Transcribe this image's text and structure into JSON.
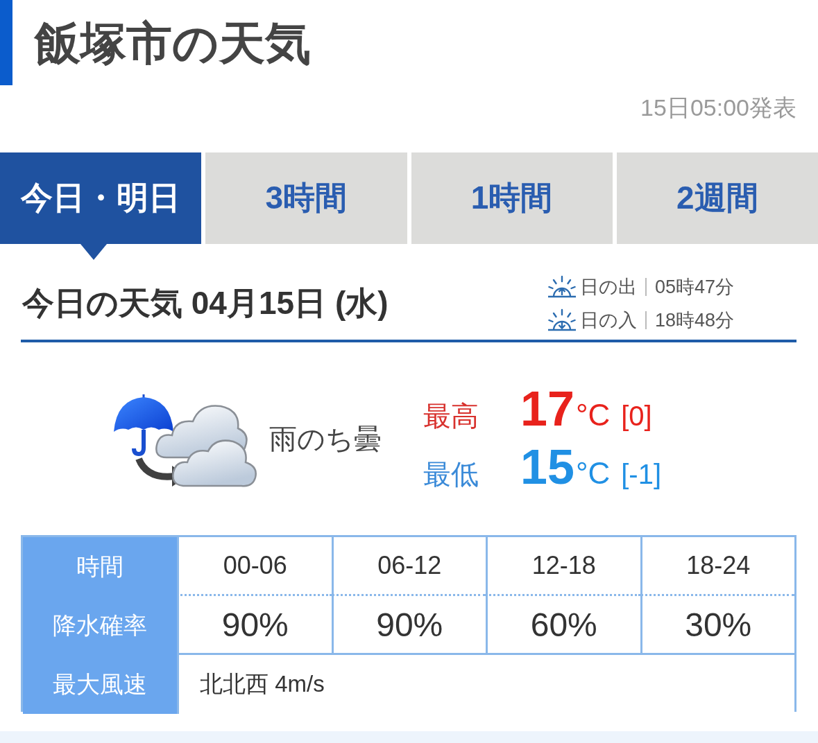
{
  "page": {
    "title": "飯塚市の天気",
    "published": "15日05:00発表"
  },
  "tabs": [
    {
      "label": "今日・明日",
      "selected": true
    },
    {
      "label": "3時間",
      "selected": false
    },
    {
      "label": "1時間",
      "selected": false
    },
    {
      "label": "2週間",
      "selected": false
    }
  ],
  "today": {
    "heading": "今日の天気 04月15日 (水)",
    "sun": [
      {
        "kind": "sunrise",
        "label": "日の出",
        "time": "05時47分"
      },
      {
        "kind": "sunset",
        "label": "日の入",
        "time": "18時48分"
      }
    ]
  },
  "forecast": {
    "weather": "雨のち曇",
    "temps": [
      {
        "kind": "high",
        "label": "最高",
        "value": "17",
        "unit": "°C",
        "diff": "[0]"
      },
      {
        "kind": "low",
        "label": "最低",
        "value": "15",
        "unit": "°C",
        "diff": "[-1]"
      }
    ]
  },
  "table": {
    "rows": [
      {
        "kind": "periods",
        "label": "時間",
        "cells": [
          "00-06",
          "06-12",
          "12-18",
          "18-24"
        ]
      },
      {
        "kind": "precip",
        "label": "降水確率",
        "cells": [
          "90%",
          "90%",
          "60%",
          "30%"
        ]
      },
      {
        "kind": "wind",
        "label": "最大風速",
        "value": "北北西 4m/s"
      }
    ]
  }
}
